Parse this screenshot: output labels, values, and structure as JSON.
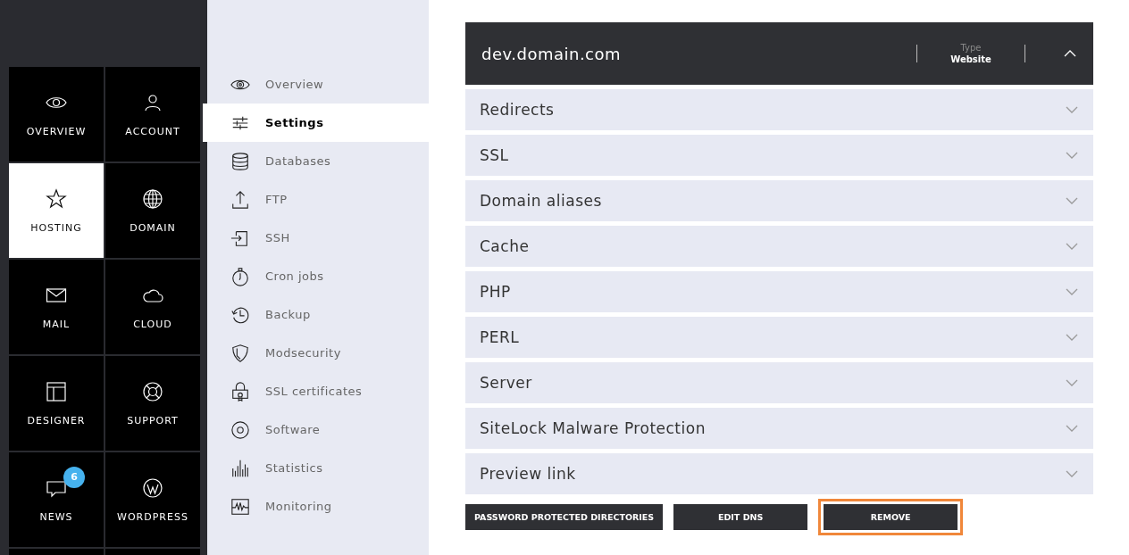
{
  "main_nav": [
    {
      "label": "OVERVIEW",
      "selected": false
    },
    {
      "label": "ACCOUNT",
      "selected": false
    },
    {
      "label": "HOSTING",
      "selected": true
    },
    {
      "label": "DOMAIN",
      "selected": false
    },
    {
      "label": "MAIL",
      "selected": false
    },
    {
      "label": "CLOUD",
      "selected": false
    },
    {
      "label": "DESIGNER",
      "selected": false
    },
    {
      "label": "SUPPORT",
      "selected": false
    },
    {
      "label": "NEWS",
      "selected": false,
      "badge": "6"
    },
    {
      "label": "WORDPRESS",
      "selected": false
    }
  ],
  "sub_nav": [
    {
      "label": "Overview",
      "selected": false
    },
    {
      "label": "Settings",
      "selected": true
    },
    {
      "label": "Databases",
      "selected": false
    },
    {
      "label": "FTP",
      "selected": false
    },
    {
      "label": "SSH",
      "selected": false
    },
    {
      "label": "Cron jobs",
      "selected": false
    },
    {
      "label": "Backup",
      "selected": false
    },
    {
      "label": "Modsecurity",
      "selected": false
    },
    {
      "label": "SSL certificates",
      "selected": false
    },
    {
      "label": "Software",
      "selected": false
    },
    {
      "label": "Statistics",
      "selected": false
    },
    {
      "label": "Monitoring",
      "selected": false
    }
  ],
  "panel": {
    "title": "dev.domain.com",
    "type_label": "Type",
    "type_value": "Website",
    "expanded": true
  },
  "sections": [
    {
      "label": "Redirects",
      "expanded": false
    },
    {
      "label": "SSL",
      "expanded": false
    },
    {
      "label": "Domain aliases",
      "expanded": false
    },
    {
      "label": "Cache",
      "expanded": false
    },
    {
      "label": "PHP",
      "expanded": false
    },
    {
      "label": "PERL",
      "expanded": false
    },
    {
      "label": "Server",
      "expanded": false
    },
    {
      "label": "SiteLock Malware Protection",
      "expanded": false
    },
    {
      "label": "Preview link",
      "expanded": false
    }
  ],
  "buttons": [
    {
      "label": "PASSWORD PROTECTED DIRECTORIES",
      "highlighted": false
    },
    {
      "label": "EDIT DNS",
      "highlighted": false
    },
    {
      "label": "REMOVE",
      "highlighted": true
    }
  ]
}
